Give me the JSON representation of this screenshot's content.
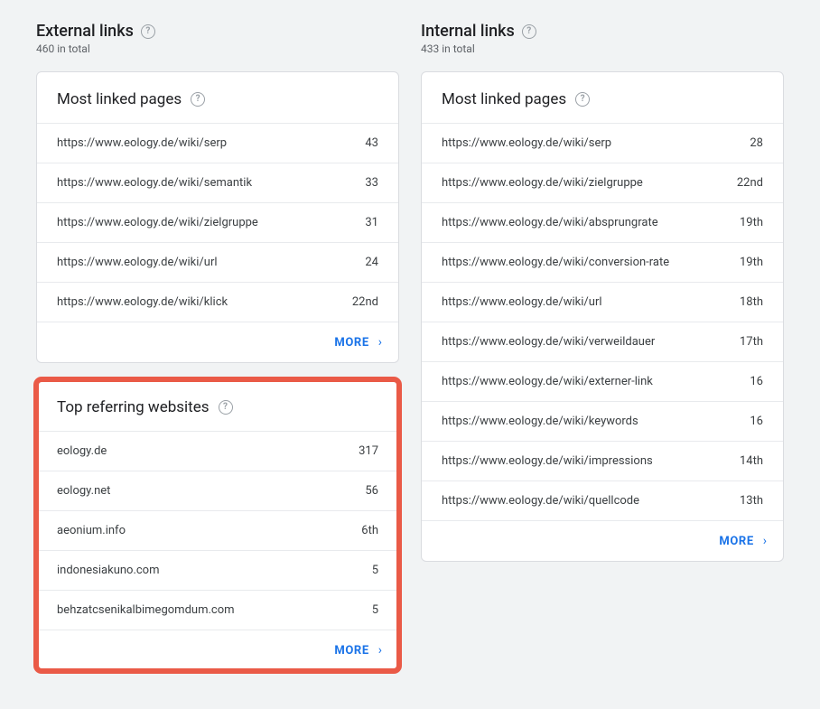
{
  "common": {
    "more_label": "MORE",
    "help_glyph": "?",
    "chevron": "›"
  },
  "external": {
    "title": "External links",
    "subtitle": "460 in total",
    "cards": [
      {
        "title": "Most linked pages",
        "rows": [
          {
            "label": "https://www.eology.de/wiki/serp",
            "value": "43"
          },
          {
            "label": "https://www.eology.de/wiki/semantik",
            "value": "33"
          },
          {
            "label": "https://www.eology.de/wiki/zielgruppe",
            "value": "31"
          },
          {
            "label": "https://www.eology.de/wiki/url",
            "value": "24"
          },
          {
            "label": "https://www.eology.de/wiki/klick",
            "value": "22nd"
          }
        ]
      },
      {
        "title": "Top referring websites",
        "highlight": true,
        "rows": [
          {
            "label": "eology.de",
            "value": "317"
          },
          {
            "label": "eology.net",
            "value": "56"
          },
          {
            "label": "aeonium.info",
            "value": "6th"
          },
          {
            "label": "indonesiakuno.com",
            "value": "5"
          },
          {
            "label": "behzatcsenikalbimegomdum.com",
            "value": "5"
          }
        ]
      }
    ]
  },
  "internal": {
    "title": "Internal links",
    "subtitle": "433 in total",
    "cards": [
      {
        "title": "Most linked pages",
        "rows": [
          {
            "label": "https://www.eology.de/wiki/serp",
            "value": "28"
          },
          {
            "label": "https://www.eology.de/wiki/zielgruppe",
            "value": "22nd"
          },
          {
            "label": "https://www.eology.de/wiki/absprungrate",
            "value": "19th"
          },
          {
            "label": "https://www.eology.de/wiki/conversion-rate",
            "value": "19th"
          },
          {
            "label": "https://www.eology.de/wiki/url",
            "value": "18th"
          },
          {
            "label": "https://www.eology.de/wiki/verweildauer",
            "value": "17th"
          },
          {
            "label": "https://www.eology.de/wiki/externer-link",
            "value": "16"
          },
          {
            "label": "https://www.eology.de/wiki/keywords",
            "value": "16"
          },
          {
            "label": "https://www.eology.de/wiki/impressions",
            "value": "14th"
          },
          {
            "label": "https://www.eology.de/wiki/quellcode",
            "value": "13th"
          }
        ]
      }
    ]
  }
}
